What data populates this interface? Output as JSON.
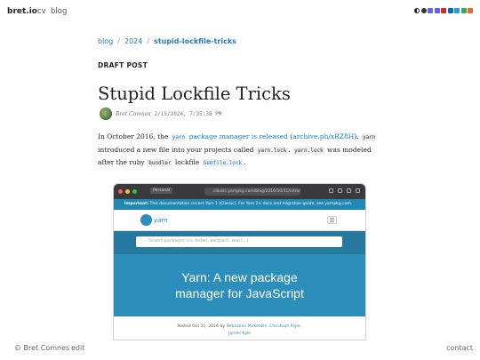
{
  "nav": {
    "brand": "bret.io",
    "links": [
      "cv",
      "blog"
    ],
    "icons": [
      {
        "name": "theme-toggle-icon",
        "color": "#222222"
      },
      {
        "name": "github-icon",
        "color": "#333333"
      },
      {
        "name": "mastodon-icon",
        "color": "#6364ff"
      },
      {
        "name": "discord-icon",
        "color": "#5865f2"
      },
      {
        "name": "youtube-icon",
        "color": "#e62117"
      },
      {
        "name": "linkedin-icon",
        "color": "#0a66c2"
      },
      {
        "name": "twitter-icon",
        "color": "#1d9bf0"
      },
      {
        "name": "email-icon",
        "color": "#3aa757"
      },
      {
        "name": "rss-icon",
        "color": "#f26522"
      }
    ]
  },
  "breadcrumb": {
    "items": [
      "blog",
      "2024"
    ],
    "separator": "/",
    "current": "stupid-lockfile-tricks"
  },
  "article": {
    "status": "DRAFT POST",
    "title": "Stupid Lockfile Tricks",
    "author": "Bret Comnes",
    "date": "2/15/2024, 7:35:38 PM",
    "para": {
      "t1": "In October 2016, the ",
      "link1_code": "yarn",
      "link1_text": " package manager is released",
      "t2": " (",
      "link2": "archive.ph/xRZ8H",
      "t3": "). ",
      "code1": "yarn",
      "t4": " introduced a new file into your projects called ",
      "code2": "yarn.lock",
      "t5": ". ",
      "code3": "yarn.lock",
      "t6": " was modeled after the ruby ",
      "code4": "bundler",
      "t7": " lockfile ",
      "link3_code": "Gemfile.lock",
      "t8": "."
    }
  },
  "screenshot": {
    "profile": "Personal",
    "url": "classic.yarnpkg.com/blog/2016/10/11/introducin...",
    "banner_bold": "Important:",
    "banner_text": " This documentation covers Yarn 1 (Classic). For Yarn 2+ docs and migration guide, see yarnpkg.com.",
    "logo": "yarn",
    "search_placeholder": "Search packages (i.e. babel, webpack, react...)",
    "hero_line1": "Yarn: A new package",
    "hero_line2": "manager for JavaScript",
    "posted_prefix": "Posted Oct 11, 2016 by ",
    "author1": "Sebastian McKenzie",
    "comma": ", ",
    "author2": "Christoph Pojer",
    "comma2": ",",
    "author3": "James Kyle",
    "accent_color": "#2c8ebb"
  },
  "footer": {
    "copyright": "© Bret Comnes",
    "edit": "edit",
    "contact": "contact"
  }
}
